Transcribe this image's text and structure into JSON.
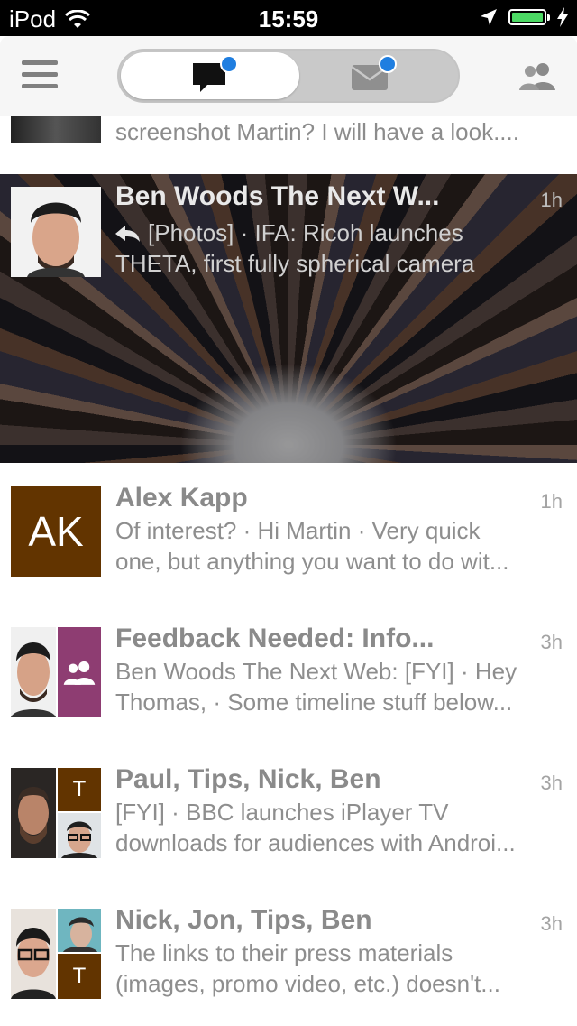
{
  "status_bar": {
    "carrier": "iPod",
    "time": "15:59"
  },
  "nav": {
    "menu_icon": "hamburger-icon",
    "tab_chat_icon": "chat-bubble-icon",
    "tab_mail_icon": "envelope-icon",
    "contacts_icon": "people-icon",
    "accent": "#1f7ee0"
  },
  "partial_row": {
    "preview": "screenshot Martin? I will have a look...."
  },
  "featured": {
    "name": "Ben Woods The Next W...",
    "time": "1h",
    "preview_line1": "[Photos] · IFA: Ricoh launches",
    "preview_line2": "THETA, first fully spherical camera"
  },
  "messages": [
    {
      "name": "Alex Kapp",
      "time": "1h",
      "initials": "AK",
      "line1": "Of interest? · Hi Martin · Very quick",
      "line2": "one, but anything you want to do wit..."
    },
    {
      "name": "Feedback Needed: Info...",
      "time": "3h",
      "line1": "Ben Woods The Next Web: [FYI] · Hey",
      "line2": "Thomas,  · Some timeline stuff below..."
    },
    {
      "name": "Paul, Tips, Nick, Ben",
      "time": "3h",
      "tile_letter": "T",
      "line1": "[FYI] · BBC launches iPlayer TV",
      "line2": "downloads for audiences with Androi..."
    },
    {
      "name": "Nick, Jon, Tips, Ben",
      "time": "3h",
      "tile_letter": "T",
      "line1": "The links to their press materials",
      "line2": "(images, promo video, etc.) doesn't..."
    }
  ]
}
